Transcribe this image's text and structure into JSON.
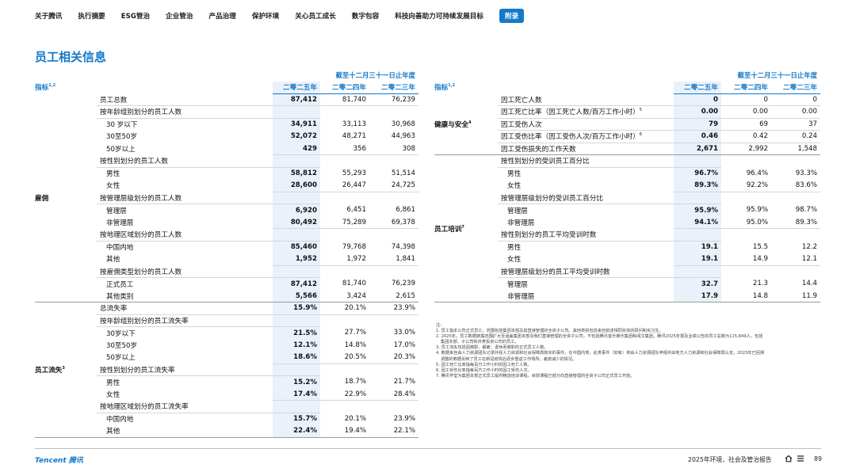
{
  "nav": {
    "items": [
      "关于腾讯",
      "执行摘要",
      "ESG管治",
      "企业管治",
      "产品治理",
      "保护环境",
      "关心员工成长",
      "数字包容",
      "科技向善助力可持续发展目标",
      "附录"
    ],
    "active_index": 9
  },
  "page_title": "员工相关信息",
  "header": {
    "period": "截至十二月三十一日止年度",
    "indicator": "指标",
    "indicator_sup": "1,2",
    "years": [
      "二零二五年",
      "二零二四年",
      "二零二三年"
    ]
  },
  "left_table": {
    "employment": {
      "category": "雇佣",
      "total_label": "员工总数",
      "total": [
        "87,412",
        "81,740",
        "76,239"
      ],
      "by_age_label": "按年龄组别划分的员工人数",
      "age_under30": {
        "label": "30 岁以下",
        "v": [
          "34,911",
          "33,113",
          "30,968"
        ]
      },
      "age_30_50": {
        "label": "30至50岁",
        "v": [
          "52,072",
          "48,271",
          "44,963"
        ]
      },
      "age_over50": {
        "label": "50岁以上",
        "v": [
          "429",
          "356",
          "308"
        ]
      },
      "by_gender_label": "按性别划分的员工人数",
      "male": {
        "label": "男性",
        "v": [
          "58,812",
          "55,293",
          "51,514"
        ]
      },
      "female": {
        "label": "女性",
        "v": [
          "28,600",
          "26,447",
          "24,725"
        ]
      },
      "by_level_label": "按管理层级划分的员工人数",
      "mgmt": {
        "label": "管理层",
        "v": [
          "6,920",
          "6,451",
          "6,861"
        ]
      },
      "nonmgmt": {
        "label": "非管理层",
        "v": [
          "80,492",
          "75,289",
          "69,378"
        ]
      },
      "by_region_label": "按地理区域划分的员工人数",
      "mainland": {
        "label": "中国内地",
        "v": [
          "85,460",
          "79,768",
          "74,398"
        ]
      },
      "other_region": {
        "label": "其他",
        "v": [
          "1,952",
          "1,972",
          "1,841"
        ]
      },
      "by_type_label": "按雇佣类型划分的员工人数",
      "fulltime": {
        "label": "正式员工",
        "v": [
          "87,412",
          "81,740",
          "76,239"
        ]
      },
      "other_type": {
        "label": "其他类别",
        "v": [
          "5,566",
          "3,424",
          "2,615"
        ]
      }
    },
    "turnover": {
      "category": "员工流失",
      "category_sup": "3",
      "total_label": "总流失率",
      "total": [
        "15.9%",
        "20.1%",
        "23.9%"
      ],
      "by_age_label": "按年龄组别划分的员工流失率",
      "age_under30": {
        "label": "30岁以下",
        "v": [
          "21.5%",
          "27.7%",
          "33.0%"
        ]
      },
      "age_30_50": {
        "label": "30至50岁",
        "v": [
          "12.1%",
          "14.8%",
          "17.0%"
        ]
      },
      "age_over50": {
        "label": "50岁以上",
        "v": [
          "18.6%",
          "20.5%",
          "20.3%"
        ]
      },
      "by_gender_label": "按性别划分的员工流失率",
      "male": {
        "label": "男性",
        "v": [
          "15.2%",
          "18.7%",
          "21.7%"
        ]
      },
      "female": {
        "label": "女性",
        "v": [
          "17.4%",
          "22.9%",
          "28.4%"
        ]
      },
      "by_region_label": "按地理区域划分的员工流失率",
      "mainland": {
        "label": "中国内地",
        "v": [
          "15.7%",
          "20.1%",
          "23.9%"
        ]
      },
      "other_region": {
        "label": "其他",
        "v": [
          "22.4%",
          "19.4%",
          "22.1%"
        ]
      }
    }
  },
  "right_table": {
    "health": {
      "category": "健康与安全",
      "category_sup": "4",
      "deaths": {
        "label": "因工死亡人数",
        "v": [
          "0",
          "0",
          "0"
        ]
      },
      "death_rate": {
        "label": "因工死亡比率（因工死亡人数/百万工作小时）",
        "sup": "5",
        "v": [
          "0.00",
          "0.00",
          "0.00"
        ]
      },
      "injuries": {
        "label": "因工受伤人次",
        "v": [
          "79",
          "69",
          "37"
        ]
      },
      "injury_rate": {
        "label": "因工受伤比率（因工受伤人次/百万工作小时）",
        "sup": "6",
        "v": [
          "0.46",
          "0.42",
          "0.24"
        ]
      },
      "lost_days": {
        "label": "因工受伤损失的工作天数",
        "v": [
          "2,671",
          "2,992",
          "1,548"
        ]
      }
    },
    "training": {
      "category": "员工培训",
      "category_sup": "7",
      "pct_gender_label": "按性别划分的受训员工百分比",
      "pct_male": {
        "label": "男性",
        "v": [
          "96.7%",
          "96.4%",
          "93.3%"
        ]
      },
      "pct_female": {
        "label": "女性",
        "v": [
          "89.3%",
          "92.2%",
          "83.6%"
        ]
      },
      "pct_level_label": "按管理层级划分的受训员工百分比",
      "pct_mgmt": {
        "label": "管理层",
        "v": [
          "95.9%",
          "95.9%",
          "98.7%"
        ]
      },
      "pct_nonmgmt": {
        "label": "非管理层",
        "v": [
          "94.1%",
          "95.0%",
          "89.3%"
        ]
      },
      "hrs_gender_label": "按性别划分的员工平均受训时数",
      "hrs_male": {
        "label": "男性",
        "v": [
          "19.1",
          "15.5",
          "12.2"
        ]
      },
      "hrs_female": {
        "label": "女性",
        "v": [
          "19.1",
          "14.9",
          "12.1"
        ]
      },
      "hrs_level_label": "按管理层级划分的员工平均受训时数",
      "hrs_mgmt": {
        "label": "管理层",
        "v": [
          "32.7",
          "21.3",
          "14.4"
        ]
      },
      "hrs_nonmgmt": {
        "label": "非管理层",
        "v": [
          "17.9",
          "14.8",
          "11.9"
        ]
      }
    }
  },
  "notes": {
    "title": "注：",
    "n1": "1. 员工指本公司正式员工，范围包括集团本部及其直接管理的全资子公司。其他类别包括来自前述相同实体的顾问和实习生。",
    "n2a": "2. 2025年，员工数据披露范围扩大至涵盖集团本部及我们直接管理的全资子公司，不包括腾讯音乐娱乐集团和阅文集团。腾讯2025年报及业绩公告的员工总数为115,849人，包括",
    "n2b": "集团本部、子公司和并表投资公司的员工。",
    "n3": "3. 员工流失包括因离职、解雇、退休而离职的正式员工人数。",
    "n4a": "4. 数据来自由人力资源团队记录并经人力资源和社会保障局核实的事件。在中国内地，此类事件（如有）将由人力资源团队申报并由地方人力资源和社会保障局认定。2023年已回溯",
    "n4b": "调整的数据反映了员工在新冠疫情后逐步重返工作场所，差旅减少的情况。",
    "n5": "5. 因工死亡比率指每百万工作小时的因工死亡人数。",
    "n6": "6. 因工受伤比率指每百万工作小时的因工受伤人次。",
    "n7": "7. 腾讯学堂为集团本部正式员工提供精选培训课程，目前课程已部分向直接管理的全资子公司正式员工开放。"
  },
  "footer": {
    "logo": "Tencent 腾讯",
    "report_title": "2025年环境、社会及管治报告",
    "page_number": "89",
    "home_icon": "home-icon",
    "menu_icon": "menu-icon"
  },
  "colors": {
    "accent": "#1479c9",
    "highlight": "#eaf1fa"
  }
}
